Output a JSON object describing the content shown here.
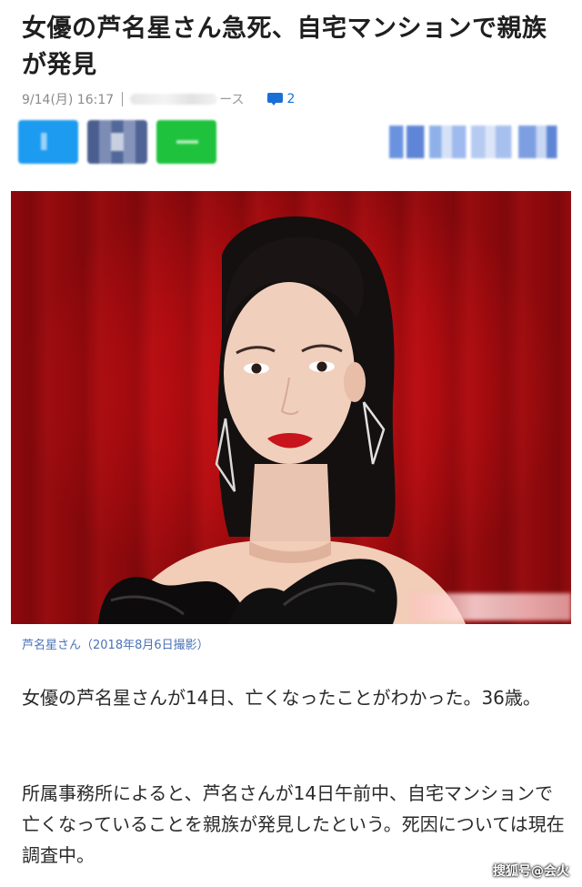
{
  "article": {
    "headline": "女優の芦名星さん急死、自宅マンションで親族が発見",
    "datetime": "9/14(月) 16:17",
    "source_visible_suffix": "ース",
    "comment_count": "2",
    "photo_caption": "芦名星さん（2018年8月6日撮影）",
    "paragraphs": [
      "女優の芦名星さんが14日、亡くなったことがわかった。36歳。",
      "所属事務所によると、芦名さんが14日午前中、自宅マンションで亡くなっていることを親族が発見したという。死因については現在調査中。"
    ]
  },
  "share": {
    "buttons": [
      "twitter-icon",
      "facebook-icon",
      "line-icon"
    ]
  },
  "watermark": "搜狐号@会火",
  "colors": {
    "accent_blue": "#1a6fd6",
    "caption_blue": "#4a72b8",
    "photo_red": "#c80f14"
  }
}
